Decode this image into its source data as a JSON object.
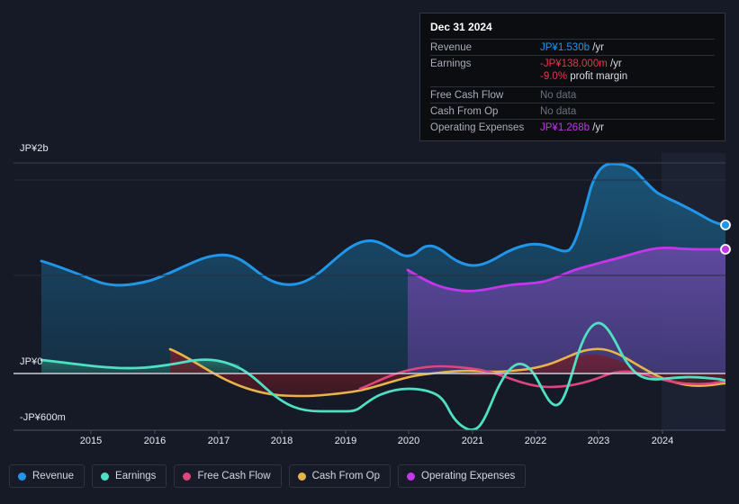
{
  "tooltip": {
    "date": "Dec 31 2024",
    "rows": [
      {
        "label": "Revenue",
        "value": "JP¥1.530b",
        "unit": " /yr",
        "color": "#2196e8"
      },
      {
        "label": "Earnings",
        "value": "-JP¥138.000m",
        "unit": " /yr",
        "color": "#e8374a"
      },
      {
        "label": "",
        "value": "-9.0%",
        "unit": " profit margin",
        "color": "#e8374a"
      },
      {
        "label": "Free Cash Flow",
        "value": "No data",
        "unit": "",
        "color": "#6a707c"
      },
      {
        "label": "Cash From Op",
        "value": "No data",
        "unit": "",
        "color": "#6a707c"
      },
      {
        "label": "Operating Expenses",
        "value": "JP¥1.268b",
        "unit": " /yr",
        "color": "#c436e8"
      }
    ]
  },
  "legend": {
    "items": [
      {
        "label": "Revenue",
        "color": "#2196e8"
      },
      {
        "label": "Earnings",
        "color": "#4fe0c4"
      },
      {
        "label": "Free Cash Flow",
        "color": "#e0457f"
      },
      {
        "label": "Cash From Op",
        "color": "#e8b44a"
      },
      {
        "label": "Operating Expenses",
        "color": "#c436e8"
      }
    ]
  },
  "axes": {
    "y_top_label": "JP¥2b",
    "y_zero_label": "JP¥0",
    "y_bottom_label": "-JP¥600m",
    "x_ticks": [
      "2015",
      "2016",
      "2017",
      "2018",
      "2019",
      "2020",
      "2021",
      "2022",
      "2023",
      "2024"
    ]
  },
  "chart_data": {
    "type": "area",
    "title": "",
    "xlabel": "",
    "ylabel": "JP¥",
    "ylim": [
      -600000000,
      2000000000
    ],
    "y_tick_labels": [
      "JP¥2b",
      "JP¥0",
      "-JP¥600m"
    ],
    "grid": true,
    "legend_position": "bottom",
    "currency": "JP¥",
    "x": [
      "2014.6",
      "2015",
      "2015.5",
      "2016",
      "2016.5",
      "2017",
      "2017.5",
      "2018",
      "2018.5",
      "2019",
      "2019.5",
      "2020",
      "2020.5",
      "2021",
      "2021.5",
      "2022",
      "2022.5",
      "2023",
      "2023.5",
      "2024",
      "2024.5",
      "2025"
    ],
    "series": [
      {
        "name": "Revenue",
        "color": "#2196e8",
        "units": "JP¥",
        "values": [
          1080,
          1010,
          900,
          870,
          930,
          1060,
          1130,
          1060,
          1000,
          1070,
          1230,
          1190,
          1100,
          1010,
          1200,
          1320,
          1300,
          1980,
          1960,
          1750,
          1620,
          1530
        ]
      },
      {
        "name": "Earnings",
        "color": "#4fe0c4",
        "units": "JP¥",
        "values": [
          30,
          20,
          5,
          10,
          25,
          20,
          -60,
          -170,
          -185,
          -185,
          -160,
          -165,
          -330,
          -470,
          -250,
          -110,
          -430,
          110,
          -60,
          -110,
          -160,
          -138
        ]
      },
      {
        "name": "Free Cash Flow",
        "color": "#e0457f",
        "units": "JP¥",
        "starts_at": "2019",
        "values": [
          null,
          null,
          null,
          null,
          null,
          null,
          null,
          null,
          null,
          -85,
          -65,
          -25,
          -20,
          -55,
          -190,
          -180,
          -90,
          -30,
          -140,
          -180,
          -170,
          null
        ]
      },
      {
        "name": "Cash From Op",
        "color": "#e8b44a",
        "units": "JP¥",
        "starts_at": "2016",
        "values": [
          null,
          null,
          null,
          40,
          -20,
          -90,
          -120,
          -115,
          -95,
          -85,
          -55,
          -30,
          -25,
          -25,
          -40,
          -20,
          15,
          45,
          -40,
          -110,
          -150,
          null
        ]
      },
      {
        "name": "Operating Expenses",
        "color": "#c436e8",
        "units": "JP¥",
        "starts_at": "2020",
        "values": [
          null,
          null,
          null,
          null,
          null,
          null,
          null,
          null,
          null,
          null,
          null,
          880,
          830,
          810,
          830,
          880,
          950,
          1000,
          1110,
          1180,
          1240,
          1268
        ]
      }
    ],
    "forecast_band": {
      "from": "2024.3",
      "to": "2025",
      "label": ""
    },
    "endpoints": [
      {
        "series": "Revenue",
        "value": 1530,
        "color": "#2196e8"
      },
      {
        "series": "Operating Expenses",
        "value": 1268,
        "color": "#c436e8"
      }
    ]
  }
}
